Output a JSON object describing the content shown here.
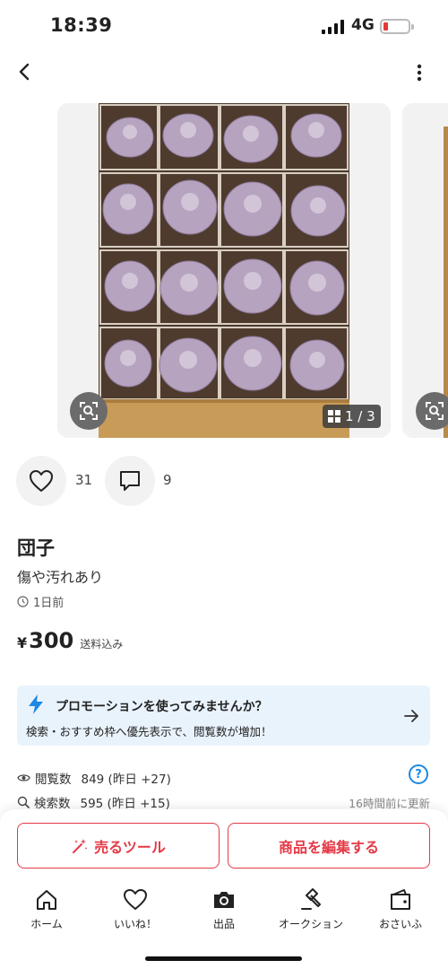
{
  "status_bar": {
    "time": "18:39",
    "network": "4G"
  },
  "gallery": {
    "counter": "1 / 3"
  },
  "reactions": {
    "likes": "31",
    "comments": "9"
  },
  "item": {
    "title": "団子",
    "condition": "傷や汚れあり",
    "posted": "1日前",
    "price_symbol": "¥",
    "price": "300",
    "shipping": "送料込み"
  },
  "promo": {
    "title": "プロモーションを使ってみませんか？",
    "description": "検索・おすすめ枠へ優先表示で、閲覧数が増加！"
  },
  "stats": {
    "views_label": "閲覧数",
    "views_value": "849 (昨日 +27)",
    "search_label": "検索数",
    "search_value": "595 (昨日 +15)",
    "updated": "16時間前に更新",
    "help": "?"
  },
  "actions": {
    "tools_label": "売るツール",
    "edit_label": "商品を編集する"
  },
  "tabbar": {
    "items": [
      {
        "label": "ホーム",
        "icon": "home-icon"
      },
      {
        "label": "いいね！",
        "icon": "heart-icon"
      },
      {
        "label": "出品",
        "icon": "camera-icon"
      },
      {
        "label": "オークション",
        "icon": "gavel-icon"
      },
      {
        "label": "おさいふ",
        "icon": "wallet-icon"
      }
    ]
  },
  "colors": {
    "accent": "#e53946",
    "info": "#1e88e5",
    "promo_bg": "#e9f3fc"
  }
}
